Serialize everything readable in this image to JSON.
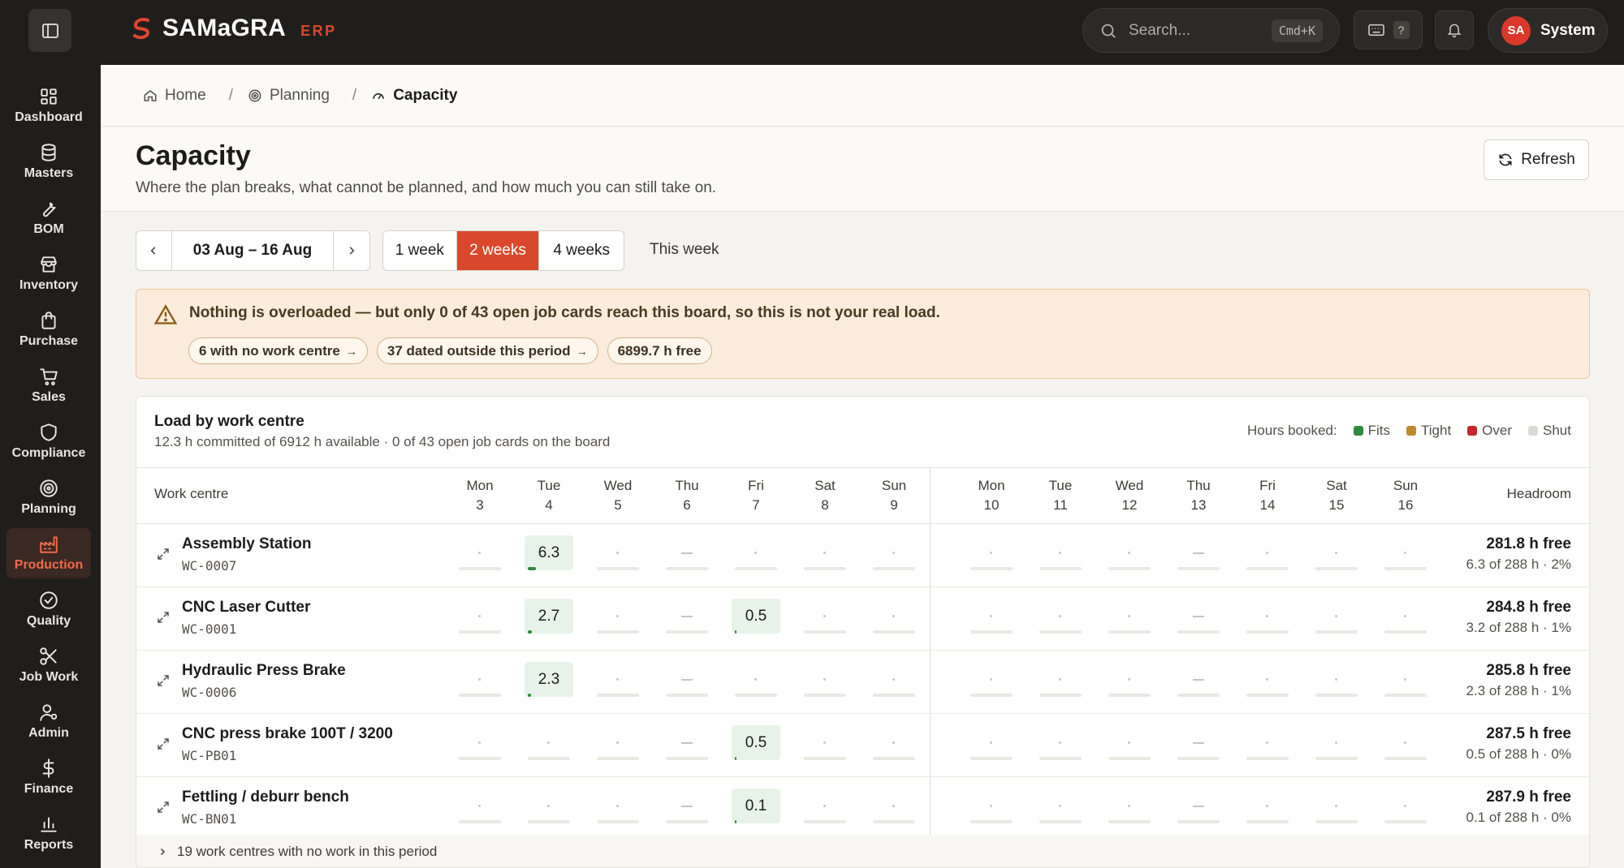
{
  "app": {
    "brand": "SAMaGRA",
    "brand_sub": "ERP"
  },
  "topbar": {
    "search_placeholder": "Search...",
    "search_shortcut": "Cmd+K",
    "help": "?",
    "user_initials": "SA",
    "user_name": "System"
  },
  "sidebar": [
    {
      "label": "Dashboard",
      "icon": "grid-icon"
    },
    {
      "label": "Masters",
      "icon": "database-icon"
    },
    {
      "label": "BOM",
      "icon": "wrench-icon"
    },
    {
      "label": "Inventory",
      "icon": "store-icon"
    },
    {
      "label": "Purchase",
      "icon": "bag-icon"
    },
    {
      "label": "Sales",
      "icon": "cart-icon"
    },
    {
      "label": "Compliance",
      "icon": "shield-icon"
    },
    {
      "label": "Planning",
      "icon": "target-icon"
    },
    {
      "label": "Production",
      "icon": "factory-icon",
      "active": true
    },
    {
      "label": "Quality",
      "icon": "check-circle-icon"
    },
    {
      "label": "Job Work",
      "icon": "scissors-icon"
    },
    {
      "label": "Admin",
      "icon": "user-gear-icon"
    },
    {
      "label": "Finance",
      "icon": "dollar-icon"
    },
    {
      "label": "Reports",
      "icon": "bar-chart-icon"
    }
  ],
  "breadcrumb": {
    "home": "Home",
    "planning": "Planning",
    "current": "Capacity",
    "sep": "/"
  },
  "header": {
    "title": "Capacity",
    "subtitle": "Where the plan breaks, what cannot be planned, and how much you can still take on.",
    "refresh": "Refresh"
  },
  "controls": {
    "date_range": "03 Aug – 16 Aug",
    "ranges": [
      "1 week",
      "2 weeks",
      "4 weeks"
    ],
    "selected_range": "2 weeks",
    "this_week": "This week"
  },
  "alert": {
    "text": "Nothing is overloaded — but only 0 of 43 open job cards reach this board, so this is not your real load.",
    "chips": [
      "6 with no work centre",
      "37 dated outside this period",
      "6899.7 h free"
    ]
  },
  "panel": {
    "title": "Load by work centre",
    "subtitle": "12.3 h committed of 6912 h available · 0 of 43 open job cards on the board",
    "legend_label": "Hours booked:",
    "legend": [
      {
        "name": "Fits",
        "color": "#2e8b3e"
      },
      {
        "name": "Tight",
        "color": "#c08a2a"
      },
      {
        "name": "Over",
        "color": "#c0282b"
      },
      {
        "name": "Shut",
        "color": "#dddad6"
      }
    ],
    "col_wc": "Work centre",
    "col_headroom": "Headroom",
    "days": [
      {
        "dow": "Mon",
        "d": "3"
      },
      {
        "dow": "Tue",
        "d": "4"
      },
      {
        "dow": "Wed",
        "d": "5"
      },
      {
        "dow": "Thu",
        "d": "6"
      },
      {
        "dow": "Fri",
        "d": "7"
      },
      {
        "dow": "Sat",
        "d": "8"
      },
      {
        "dow": "Sun",
        "d": "9"
      },
      {
        "dow": "Mon",
        "d": "10"
      },
      {
        "dow": "Tue",
        "d": "11"
      },
      {
        "dow": "Wed",
        "d": "12"
      },
      {
        "dow": "Thu",
        "d": "13"
      },
      {
        "dow": "Fri",
        "d": "14"
      },
      {
        "dow": "Sat",
        "d": "15"
      },
      {
        "dow": "Sun",
        "d": "16"
      }
    ],
    "rows": [
      {
        "name": "Assembly Station",
        "code": "WC-0007",
        "free": "281.8 h free",
        "of": "6.3 of 288 h · 2%",
        "cells": [
          null,
          "6.3",
          null,
          "-",
          null,
          null,
          null,
          null,
          null,
          null,
          "-",
          null,
          null,
          null
        ],
        "loads": [
          0,
          0.2,
          0,
          0,
          0,
          0,
          0,
          0,
          0,
          0,
          0,
          0,
          0,
          0
        ]
      },
      {
        "name": "CNC Laser Cutter",
        "code": "WC-0001",
        "free": "284.8 h free",
        "of": "3.2 of 288 h · 1%",
        "cells": [
          null,
          "2.7",
          null,
          "-",
          "0.5",
          null,
          null,
          null,
          null,
          null,
          "-",
          null,
          null,
          null
        ],
        "loads": [
          0,
          0.1,
          0,
          0,
          0.02,
          0,
          0,
          0,
          0,
          0,
          0,
          0,
          0,
          0
        ]
      },
      {
        "name": "Hydraulic Press Brake",
        "code": "WC-0006",
        "free": "285.8 h free",
        "of": "2.3 of 288 h · 1%",
        "cells": [
          null,
          "2.3",
          null,
          "-",
          null,
          null,
          null,
          null,
          null,
          null,
          "-",
          null,
          null,
          null
        ],
        "loads": [
          0,
          0.08,
          0,
          0,
          0,
          0,
          0,
          0,
          0,
          0,
          0,
          0,
          0,
          0
        ]
      },
      {
        "name": "CNC press brake 100T / 3200",
        "code": "WC-PB01",
        "free": "287.5 h free",
        "of": "0.5 of 288 h · 0%",
        "cells": [
          null,
          null,
          null,
          "-",
          "0.5",
          null,
          null,
          null,
          null,
          null,
          "-",
          null,
          null,
          null
        ],
        "loads": [
          0,
          0,
          0,
          0,
          0.02,
          0,
          0,
          0,
          0,
          0,
          0,
          0,
          0,
          0
        ]
      },
      {
        "name": "Fettling / deburr bench",
        "code": "WC-BN01",
        "free": "287.9 h free",
        "of": "0.1 of 288 h · 0%",
        "cells": [
          null,
          null,
          null,
          "-",
          "0.1",
          null,
          null,
          null,
          null,
          null,
          "-",
          null,
          null,
          null
        ],
        "loads": [
          0,
          0,
          0,
          0,
          0.01,
          0,
          0,
          0,
          0,
          0,
          0,
          0,
          0,
          0
        ]
      }
    ],
    "footer": "19 work centres with no work in this period"
  }
}
